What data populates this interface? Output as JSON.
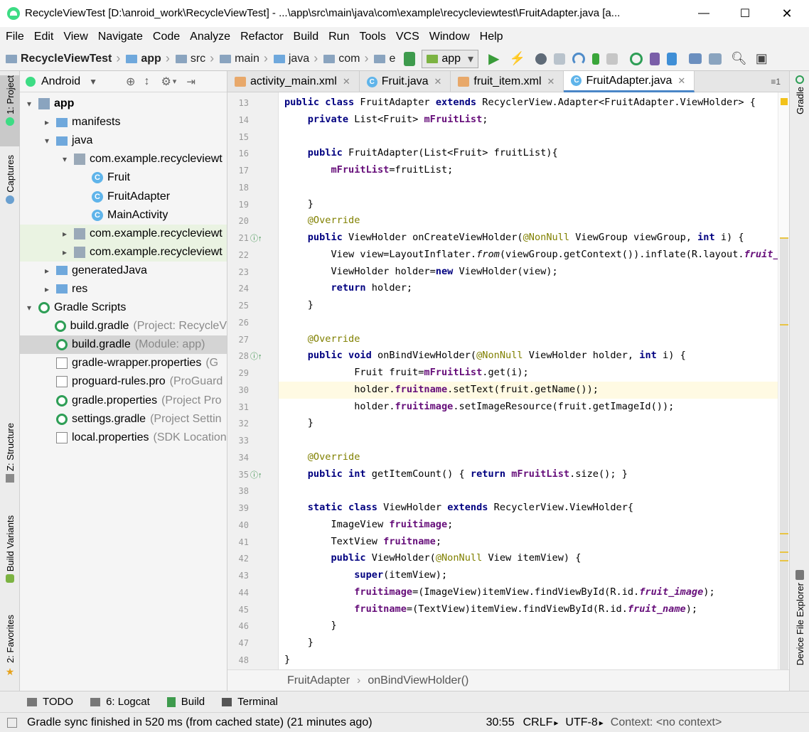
{
  "window": {
    "title": "RecycleViewTest [D:\\anroid_work\\RecycleViewTest] - ...\\app\\src\\main\\java\\com\\example\\recycleviewtest\\FruitAdapter.java [a..."
  },
  "menu": [
    "File",
    "Edit",
    "View",
    "Navigate",
    "Code",
    "Analyze",
    "Refactor",
    "Build",
    "Run",
    "Tools",
    "VCS",
    "Window",
    "Help"
  ],
  "nav": {
    "crumbs": [
      "RecycleViewTest",
      "app",
      "src",
      "main",
      "java",
      "com",
      "e"
    ],
    "run_config": "app"
  },
  "left_stripe": [
    "1: Project",
    "Captures",
    "Z: Structure",
    "Build Variants",
    "2: Favorites"
  ],
  "right_stripe": [
    "Gradle",
    "Device File Explorer"
  ],
  "project": {
    "view": "Android",
    "tree": [
      {
        "label": "app",
        "dim": "",
        "indent": 0,
        "arrow": "▾",
        "icon": "mod",
        "bold": true
      },
      {
        "label": "manifests",
        "dim": "",
        "indent": 1,
        "arrow": "▸",
        "icon": "folder"
      },
      {
        "label": "java",
        "dim": "",
        "indent": 1,
        "arrow": "▾",
        "icon": "folder"
      },
      {
        "label": "com.example.recycleviewt",
        "dim": "",
        "indent": 2,
        "arrow": "▾",
        "icon": "pkg"
      },
      {
        "label": "Fruit",
        "dim": "",
        "indent": 3,
        "arrow": "",
        "icon": "cls"
      },
      {
        "label": "FruitAdapter",
        "dim": "",
        "indent": 3,
        "arrow": "",
        "icon": "cls"
      },
      {
        "label": "MainActivity",
        "dim": "",
        "indent": 3,
        "arrow": "",
        "icon": "cls"
      },
      {
        "label": "com.example.recycleviewt",
        "dim": "",
        "indent": 2,
        "arrow": "▸",
        "icon": "pkg",
        "hl": true
      },
      {
        "label": "com.example.recycleviewt",
        "dim": "",
        "indent": 2,
        "arrow": "▸",
        "icon": "pkg",
        "hl": true
      },
      {
        "label": "generatedJava",
        "dim": "",
        "indent": 1,
        "arrow": "▸",
        "icon": "folder"
      },
      {
        "label": "res",
        "dim": "",
        "indent": 1,
        "arrow": "▸",
        "icon": "folder"
      },
      {
        "label": "Gradle Scripts",
        "dim": "",
        "indent": 0,
        "arrow": "▾",
        "icon": "gradle"
      },
      {
        "label": "build.gradle",
        "dim": "(Project: RecycleV",
        "indent": 1,
        "arrow": "",
        "icon": "gradle"
      },
      {
        "label": "build.gradle",
        "dim": "(Module: app)",
        "indent": 1,
        "arrow": "",
        "icon": "gradle",
        "sel": true
      },
      {
        "label": "gradle-wrapper.properties",
        "dim": "(G",
        "indent": 1,
        "arrow": "",
        "icon": "doc"
      },
      {
        "label": "proguard-rules.pro",
        "dim": "(ProGuard",
        "indent": 1,
        "arrow": "",
        "icon": "doc"
      },
      {
        "label": "gradle.properties",
        "dim": "(Project Pro",
        "indent": 1,
        "arrow": "",
        "icon": "gradle"
      },
      {
        "label": "settings.gradle",
        "dim": "(Project Settin",
        "indent": 1,
        "arrow": "",
        "icon": "gradle"
      },
      {
        "label": "local.properties",
        "dim": "(SDK Location",
        "indent": 1,
        "arrow": "",
        "icon": "doc"
      }
    ]
  },
  "tabs": [
    {
      "label": "activity_main.xml",
      "type": "xml"
    },
    {
      "label": "Fruit.java",
      "type": "cls"
    },
    {
      "label": "fruit_item.xml",
      "type": "xml"
    },
    {
      "label": "FruitAdapter.java",
      "type": "cls",
      "active": true
    }
  ],
  "tabs_overflow": "≡1",
  "code": [
    {
      "n": "13",
      "t": [
        [
          "kw",
          "public class "
        ],
        [
          "",
          "FruitAdapter "
        ],
        [
          "kw",
          "extends "
        ],
        [
          "",
          "RecyclerView.Adapter<FruitAdapter.ViewHolder> {"
        ]
      ]
    },
    {
      "n": "14",
      "t": [
        [
          "",
          "    "
        ],
        [
          "kw",
          "private "
        ],
        [
          "",
          "List<Fruit> "
        ],
        [
          "fld",
          "mFruitList"
        ],
        [
          "",
          ";"
        ]
      ]
    },
    {
      "n": "15",
      "t": []
    },
    {
      "n": "16",
      "t": [
        [
          "",
          "    "
        ],
        [
          "kw",
          "public "
        ],
        [
          "",
          "FruitAdapter(List<Fruit> fruitList){"
        ]
      ]
    },
    {
      "n": "17",
      "t": [
        [
          "",
          "        "
        ],
        [
          "fld",
          "mFruitList"
        ],
        [
          "",
          "=fruitList;"
        ]
      ]
    },
    {
      "n": "18",
      "t": []
    },
    {
      "n": "19",
      "t": [
        [
          "",
          "    }"
        ]
      ]
    },
    {
      "n": "20",
      "t": [
        [
          "",
          "    "
        ],
        [
          "ann",
          "@Override"
        ]
      ]
    },
    {
      "n": "21",
      "t": [
        [
          "",
          "    "
        ],
        [
          "kw",
          "public "
        ],
        [
          "",
          "ViewHolder onCreateViewHolder("
        ],
        [
          "ann",
          "@NonNull "
        ],
        [
          "",
          "ViewGroup viewGroup, "
        ],
        [
          "kw",
          "int "
        ],
        [
          "",
          "i) {"
        ]
      ],
      "mark": "up"
    },
    {
      "n": "22",
      "t": [
        [
          "",
          "        View view=LayoutInflater."
        ],
        [
          "it",
          "from"
        ],
        [
          "",
          "(viewGroup.getContext()).inflate(R.layout."
        ],
        [
          "fld it",
          "fruit_ite"
        ]
      ]
    },
    {
      "n": "23",
      "t": [
        [
          "",
          "        ViewHolder holder="
        ],
        [
          "kw",
          "new "
        ],
        [
          "",
          "ViewHolder(view);"
        ]
      ]
    },
    {
      "n": "24",
      "t": [
        [
          "",
          "        "
        ],
        [
          "kw",
          "return "
        ],
        [
          "",
          "holder;"
        ]
      ]
    },
    {
      "n": "25",
      "t": [
        [
          "",
          "    }"
        ]
      ]
    },
    {
      "n": "26",
      "t": []
    },
    {
      "n": "27",
      "t": [
        [
          "",
          "    "
        ],
        [
          "ann",
          "@Override"
        ]
      ]
    },
    {
      "n": "28",
      "t": [
        [
          "",
          "    "
        ],
        [
          "kw",
          "public void "
        ],
        [
          "",
          "onBindViewHolder("
        ],
        [
          "ann",
          "@NonNull "
        ],
        [
          "",
          "ViewHolder holder, "
        ],
        [
          "kw",
          "int "
        ],
        [
          "",
          "i) {"
        ]
      ],
      "mark": "up"
    },
    {
      "n": "29",
      "t": [
        [
          "",
          "            Fruit fruit="
        ],
        [
          "fld",
          "mFruitList"
        ],
        [
          "",
          ".get(i);"
        ]
      ]
    },
    {
      "n": "30",
      "t": [
        [
          "",
          "            holder."
        ],
        [
          "fld",
          "fruitname"
        ],
        [
          "",
          ".setText(fruit.getName());"
        ]
      ],
      "cur": true
    },
    {
      "n": "31",
      "t": [
        [
          "",
          "            holder."
        ],
        [
          "fld",
          "fruitimage"
        ],
        [
          "",
          ".setImageResource(fruit.getImageId());"
        ]
      ]
    },
    {
      "n": "32",
      "t": [
        [
          "",
          "    }"
        ]
      ]
    },
    {
      "n": "33",
      "t": []
    },
    {
      "n": "34",
      "t": [
        [
          "",
          "    "
        ],
        [
          "ann",
          "@Override"
        ]
      ]
    },
    {
      "n": "35",
      "t": [
        [
          "",
          "    "
        ],
        [
          "kw",
          "public int "
        ],
        [
          "",
          "getItemCount() { "
        ],
        [
          "kw",
          "return "
        ],
        [
          "fld",
          "mFruitList"
        ],
        [
          "",
          ".size(); }"
        ]
      ],
      "mark": "up"
    },
    {
      "n": "38",
      "t": []
    },
    {
      "n": "39",
      "t": [
        [
          "",
          "    "
        ],
        [
          "kw",
          "static class "
        ],
        [
          "",
          "ViewHolder "
        ],
        [
          "kw",
          "extends "
        ],
        [
          "",
          "RecyclerView.ViewHolder{"
        ]
      ]
    },
    {
      "n": "40",
      "t": [
        [
          "",
          "        ImageView "
        ],
        [
          "fld",
          "fruitimage"
        ],
        [
          "",
          ";"
        ]
      ]
    },
    {
      "n": "41",
      "t": [
        [
          "",
          "        TextView "
        ],
        [
          "fld",
          "fruitname"
        ],
        [
          "",
          ";"
        ]
      ]
    },
    {
      "n": "42",
      "t": [
        [
          "",
          "        "
        ],
        [
          "kw",
          "public "
        ],
        [
          "",
          "ViewHolder("
        ],
        [
          "ann",
          "@NonNull "
        ],
        [
          "",
          "View itemView) {"
        ]
      ]
    },
    {
      "n": "43",
      "t": [
        [
          "",
          "            "
        ],
        [
          "kw",
          "super"
        ],
        [
          "",
          "(itemView);"
        ]
      ]
    },
    {
      "n": "44",
      "t": [
        [
          "",
          "            "
        ],
        [
          "fld",
          "fruitimage"
        ],
        [
          "",
          "=(ImageView)itemView.findViewById(R.id."
        ],
        [
          "fld it",
          "fruit_image"
        ],
        [
          "",
          ");"
        ]
      ]
    },
    {
      "n": "45",
      "t": [
        [
          "",
          "            "
        ],
        [
          "fld",
          "fruitname"
        ],
        [
          "",
          "=(TextView)itemView.findViewById(R.id."
        ],
        [
          "fld it",
          "fruit_name"
        ],
        [
          "",
          ");"
        ]
      ]
    },
    {
      "n": "46",
      "t": [
        [
          "",
          "        }"
        ]
      ]
    },
    {
      "n": "47",
      "t": [
        [
          "",
          "    }"
        ]
      ]
    },
    {
      "n": "48",
      "t": [
        [
          "",
          "}"
        ]
      ]
    }
  ],
  "editor_crumbs": [
    "FruitAdapter",
    "onBindViewHolder()"
  ],
  "tool_tabs": [
    "TODO",
    "6: Logcat",
    "Build",
    "Terminal"
  ],
  "status": {
    "message": "Gradle sync finished in 520 ms (from cached state) (21 minutes ago)",
    "position": "30:55",
    "line_sep": "CRLF",
    "encoding": "UTF-8",
    "context": "Context: <no context>"
  },
  "colors": {
    "keyword": "#000080",
    "field": "#660e7a",
    "annotation": "#808000",
    "accent": "#4a86c7"
  }
}
